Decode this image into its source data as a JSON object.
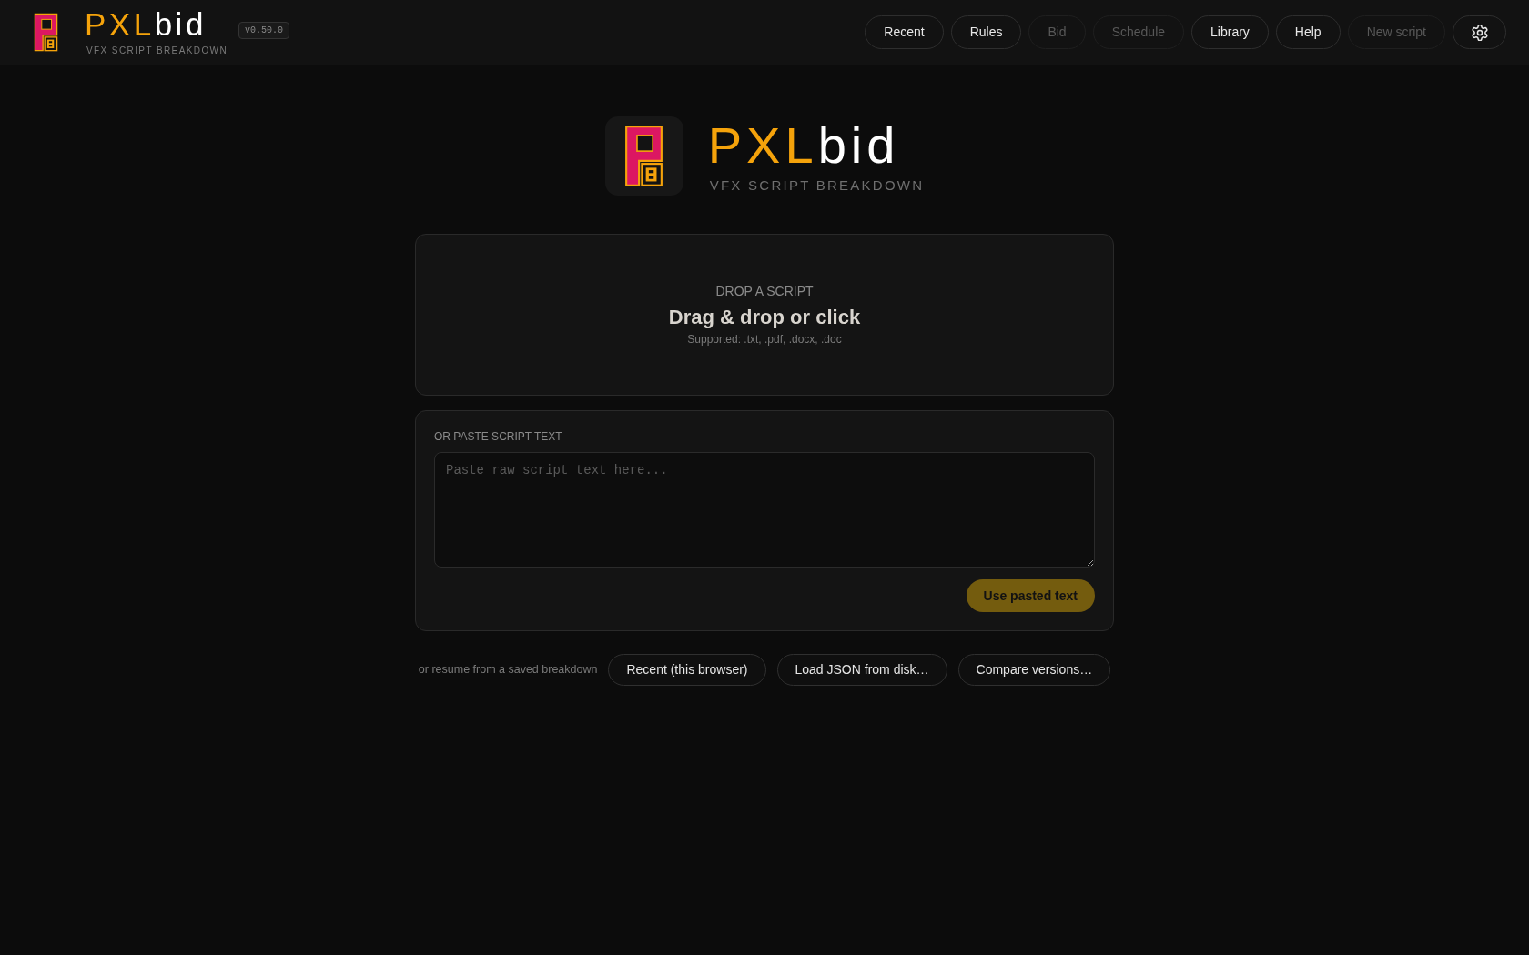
{
  "header": {
    "logo": {
      "brand_primary": "PXL",
      "brand_secondary": "bid",
      "tagline": "VFX SCRIPT BREAKDOWN"
    },
    "version": "v0.50.0",
    "nav": [
      {
        "kind": "text",
        "label": "Recent",
        "disabled": false
      },
      {
        "kind": "text",
        "label": "Rules",
        "disabled": false
      },
      {
        "kind": "text",
        "label": "Bid",
        "disabled": true
      },
      {
        "kind": "text",
        "label": "Schedule",
        "disabled": true
      },
      {
        "kind": "text",
        "label": "Library",
        "disabled": false
      },
      {
        "kind": "text",
        "label": "Help",
        "disabled": false
      },
      {
        "kind": "text",
        "label": "New script",
        "disabled": true
      },
      {
        "kind": "settings",
        "disabled": false
      }
    ]
  },
  "hero": {
    "brand_primary": "PXL",
    "brand_secondary": "bid",
    "tagline": "VFX SCRIPT BREAKDOWN"
  },
  "drop_zone": {
    "eyebrow": "DROP A SCRIPT",
    "title": "Drag & drop or click",
    "hint": "Supported: .txt, .pdf, .docx, .doc"
  },
  "paste": {
    "label": "OR PASTE SCRIPT TEXT",
    "textarea": {
      "placeholder": "Paste raw script text here..."
    },
    "submit": {
      "label": "Use pasted text",
      "disabled": true
    }
  },
  "resume": {
    "prompt": "or resume from a saved breakdown",
    "buttons": [
      "Recent (this browser)",
      "Load JSON from disk…",
      "Compare versions…"
    ]
  }
}
